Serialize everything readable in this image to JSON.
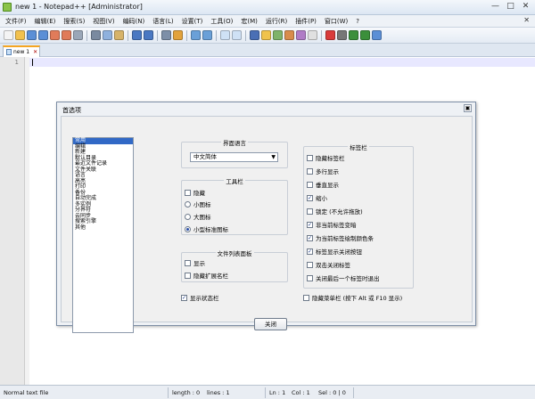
{
  "window": {
    "title": "new 1 - Notepad++ [Administrator]"
  },
  "menu": [
    "文件(F)",
    "编辑(E)",
    "搜索(S)",
    "视图(V)",
    "编码(N)",
    "语言(L)",
    "设置(T)",
    "工具(O)",
    "宏(M)",
    "运行(R)",
    "插件(P)",
    "窗口(W)",
    "?"
  ],
  "toolbar": {
    "icons": [
      {
        "name": "new-file-icon",
        "color": "#f4f4f4"
      },
      {
        "name": "open-file-icon",
        "color": "#f2c14e"
      },
      {
        "name": "save-icon",
        "color": "#5b8fd6"
      },
      {
        "name": "save-all-icon",
        "color": "#5b8fd6"
      },
      {
        "name": "close-icon",
        "color": "#e07b5a"
      },
      {
        "name": "close-all-icon",
        "color": "#e07b5a"
      },
      {
        "name": "print-icon",
        "color": "#9aa7b8"
      },
      {
        "name": "sep"
      },
      {
        "name": "cut-icon",
        "color": "#7a8aa0"
      },
      {
        "name": "copy-icon",
        "color": "#8fb1de"
      },
      {
        "name": "paste-icon",
        "color": "#d6b36a"
      },
      {
        "name": "sep"
      },
      {
        "name": "undo-icon",
        "color": "#4a78c2"
      },
      {
        "name": "redo-icon",
        "color": "#4a78c2"
      },
      {
        "name": "sep"
      },
      {
        "name": "find-icon",
        "color": "#7d8fa8"
      },
      {
        "name": "replace-icon",
        "color": "#e2a23b"
      },
      {
        "name": "sep"
      },
      {
        "name": "zoom-in-icon",
        "color": "#6aa0d8"
      },
      {
        "name": "zoom-out-icon",
        "color": "#6aa0d8"
      },
      {
        "name": "sep"
      },
      {
        "name": "sync-v-icon",
        "color": "#cfe1f5"
      },
      {
        "name": "sync-h-icon",
        "color": "#cfe1f5"
      },
      {
        "name": "sep"
      },
      {
        "name": "word-wrap-icon",
        "color": "#4a6fb5"
      },
      {
        "name": "show-all-chars-icon",
        "color": "#f0c34c"
      },
      {
        "name": "indent-guide-icon",
        "color": "#7fb36a"
      },
      {
        "name": "doc-map-icon",
        "color": "#d88c4c"
      },
      {
        "name": "lang-icon",
        "color": "#b07cc6"
      },
      {
        "name": "function-list-icon",
        "color": "#e0e0e0"
      },
      {
        "name": "sep"
      },
      {
        "name": "record-macro-icon",
        "color": "#d93b3b"
      },
      {
        "name": "stop-record-icon",
        "color": "#777777"
      },
      {
        "name": "play-macro-icon",
        "color": "#3b8f3b"
      },
      {
        "name": "run-macro-icon",
        "color": "#3b8f3b"
      },
      {
        "name": "save-macro-icon",
        "color": "#5b8fd6"
      }
    ]
  },
  "tab": {
    "label": "new 1",
    "close": "✕"
  },
  "editor": {
    "line_number": "1"
  },
  "dialog": {
    "title": "首选项",
    "close_glyph": "▣",
    "categories": [
      "常用",
      "编辑",
      "新建",
      "默认目录",
      "最近文件记录",
      "文件关联",
      "语言",
      "高亮",
      "打印",
      "备份",
      "自动完成",
      "多实例",
      "分界符",
      "云同步",
      "搜索引擎",
      "其他"
    ],
    "selected_category": 0,
    "ui_language": {
      "title": "界面语言",
      "value": "中文简体"
    },
    "toolbar_group": {
      "title": "工具栏",
      "hide": {
        "label": "隐藏",
        "checked": false
      },
      "radios": [
        {
          "label": "小图标",
          "on": false
        },
        {
          "label": "大图标",
          "on": false
        },
        {
          "label": "小型标准图标",
          "on": true
        }
      ]
    },
    "doclist_group": {
      "title": "文件列表面板",
      "items": [
        {
          "label": "显示",
          "checked": false
        },
        {
          "label": "隐藏扩展名栏",
          "checked": false
        }
      ]
    },
    "show_statusbar": {
      "label": "显示状态栏",
      "checked": true
    },
    "tabbar_group": {
      "title": "标签栏",
      "items": [
        {
          "label": "隐藏标签栏",
          "checked": false
        },
        {
          "label": "多行显示",
          "checked": false
        },
        {
          "label": "垂直显示",
          "checked": false
        },
        {
          "label": "缩小",
          "checked": true
        },
        {
          "label": "锁定 (不允许拖放)",
          "checked": false
        },
        {
          "label": "非当前标签变暗",
          "checked": true
        },
        {
          "label": "为当前标签绘制颜色条",
          "checked": true
        },
        {
          "label": "标签显示关闭按钮",
          "checked": true
        },
        {
          "label": "双击关闭标签",
          "checked": false
        },
        {
          "label": "关闭最后一个标签时退出",
          "checked": false
        }
      ]
    },
    "hide_menubar": {
      "label": "隐藏菜单栏 (按下 Alt 或 F10 显示)",
      "checked": false
    },
    "close_button": "关闭"
  },
  "status": {
    "doc_type": "Normal text file",
    "length": "length : 0",
    "lines": "lines : 1",
    "ln": "Ln : 1",
    "col": "Col : 1",
    "sel": "Sel : 0 | 0"
  },
  "colors": {
    "accent": "#3169c6",
    "tab_highlight": "#f5a623",
    "current_line": "#e8e8ff"
  }
}
